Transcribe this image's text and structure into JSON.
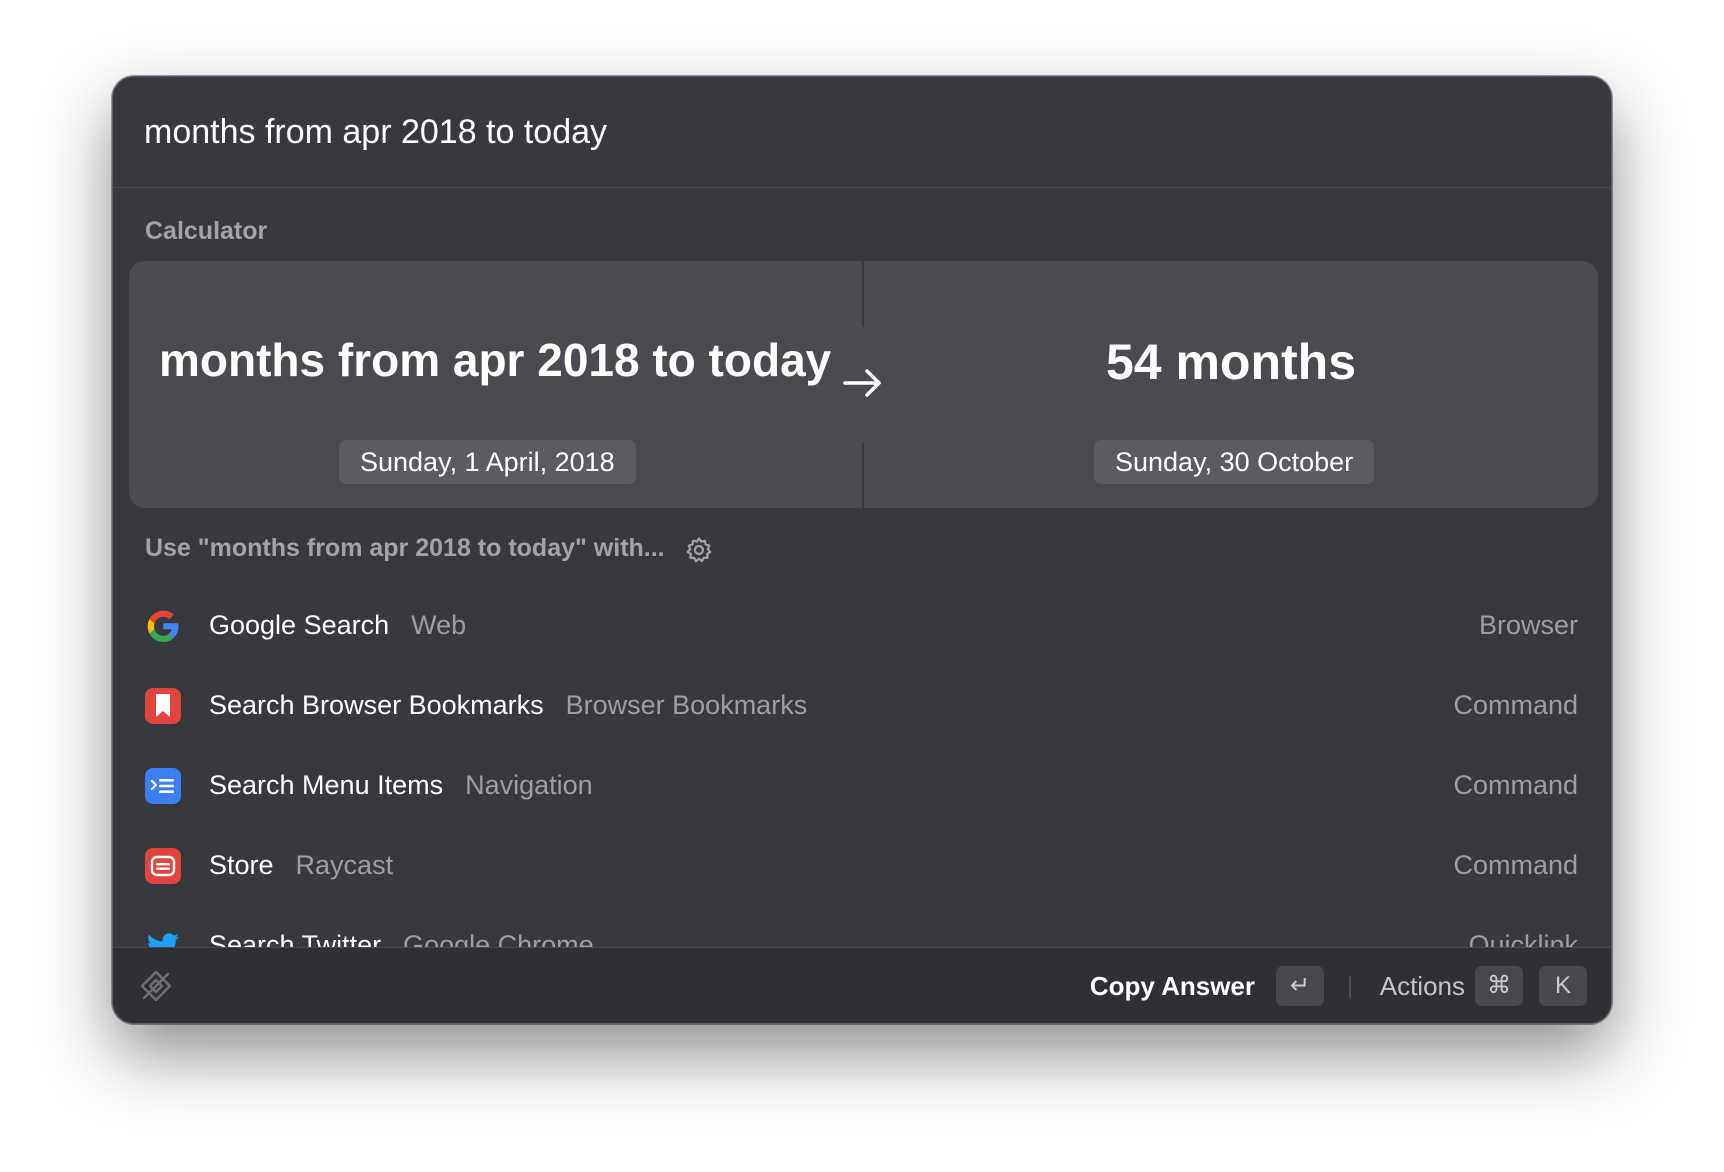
{
  "search": {
    "query": "months from apr 2018 to today"
  },
  "calculator": {
    "section_title": "Calculator",
    "expression": "months from apr 2018 to today",
    "expression_sub": "Sunday, 1 April, 2018",
    "result": "54 months",
    "result_sub": "Sunday, 30 October"
  },
  "use_with": {
    "label": "Use \"months from apr 2018 to today\" with..."
  },
  "list": {
    "items": [
      {
        "title": "Google Search",
        "subtitle": "Web",
        "kind": "Browser",
        "icon": "google-icon"
      },
      {
        "title": "Search Browser Bookmarks",
        "subtitle": "Browser Bookmarks",
        "kind": "Command",
        "icon": "bookmark-icon"
      },
      {
        "title": "Search Menu Items",
        "subtitle": "Navigation",
        "kind": "Command",
        "icon": "menu-items-icon"
      },
      {
        "title": "Store",
        "subtitle": "Raycast",
        "kind": "Command",
        "icon": "store-icon"
      },
      {
        "title": "Search Twitter",
        "subtitle": "Google Chrome",
        "kind": "Quicklink",
        "icon": "twitter-icon"
      }
    ]
  },
  "footer": {
    "primary_action": "Copy Answer",
    "enter_key": "↵",
    "actions_label": "Actions",
    "cmd_key": "⌘",
    "k_key": "K"
  },
  "colors": {
    "window_bg": "#38393e",
    "card_bg": "#4a4b50",
    "footer_bg": "#2f3035",
    "text_primary": "#ffffff",
    "text_secondary": "#9d9ea3",
    "bookmark_red": "#e0443c",
    "menu_blue": "#3d7ff2",
    "twitter_blue": "#1da1f2"
  }
}
